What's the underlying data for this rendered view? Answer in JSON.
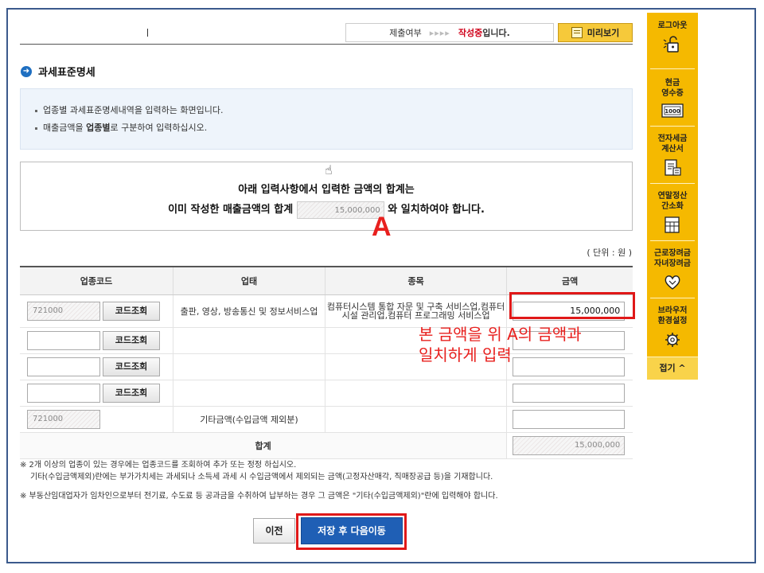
{
  "status": {
    "label": "제출여부",
    "arrows": "▸▸▸▸",
    "state": "작성중",
    "suffix": "입니다."
  },
  "preview_label": "미리보기",
  "section_title": "과세표준명세",
  "info": {
    "line1": "업종별 과세표준명세내역을 입력하는 화면입니다.",
    "line2_pre": "매출금액을 ",
    "line2_bold": "업종별",
    "line2_post": "로 구분하여 입력하십시오."
  },
  "notice": {
    "line1": "아래 입력사항에서  입력한 금액의 합계는",
    "line2_pre": "이미 작성한 매출금액의 합계",
    "sum_value": "15,000,000",
    "line2_post": "와 일치하여야 합니다."
  },
  "annotation_A": "A",
  "unit": "( 단위 : 원 )",
  "table": {
    "headers": [
      "업종코드",
      "업태",
      "종목",
      "금액"
    ],
    "code_button": "코드조회",
    "row1": {
      "code": "721000",
      "category": "출판, 영상, 방송통신 및 정보서비스업",
      "item": "컴퓨터시스템 통합 자문 및 구축 서비스업,컴퓨터시설 관리업,컴퓨터 프로그래밍 서비스업",
      "amount": "15,000,000"
    },
    "other_row": {
      "code": "721000",
      "label": "기타금액(수입금액 제외분)"
    },
    "total_label": "합계",
    "total_value": "15,000,000"
  },
  "red_note": {
    "line1": "본 금액을 위 A의 금액과",
    "line2": "일치하게 입력"
  },
  "footnotes": {
    "f1a": "※ 2개 이상의 업종이 있는 경우에는 업종코드를 조회하여 추가 또는 정정 하십시오.",
    "f1b": "기타(수입금액제외)란에는 부가가치세는 과세되나 소득세 과세 시 수입금액에서 제외되는 금액(고정자산매각, 직매장공급 등)을 기재합니다.",
    "f2": "※ 부동산임대업자가 임차인으로부터 전기료, 수도료 등 공과금을 수취하여 납부하는 경우 그 금액은 \"기타(수입금액제외)\"란에 입력해야 합니다."
  },
  "buttons": {
    "prev": "이전",
    "next": "저장 후 다음이동"
  },
  "sidebar": {
    "logout": "로그아웃",
    "cash1": "현금",
    "cash2": "영수증",
    "etax1": "전자세금",
    "etax2": "계산서",
    "yearend1": "연말정산",
    "yearend2": "간소화",
    "incentive1": "근로장려금",
    "incentive2": "자녀장려금",
    "browser1": "브라우저",
    "browser2": "환경설정",
    "fold": "접기 ^",
    "receipt_number": "1000"
  },
  "colors": {
    "accent_blue": "#1f5fb5",
    "sidebar_yellow": "#f5b900",
    "annotation_red": "#e8201e",
    "status_red": "#d0021b"
  }
}
